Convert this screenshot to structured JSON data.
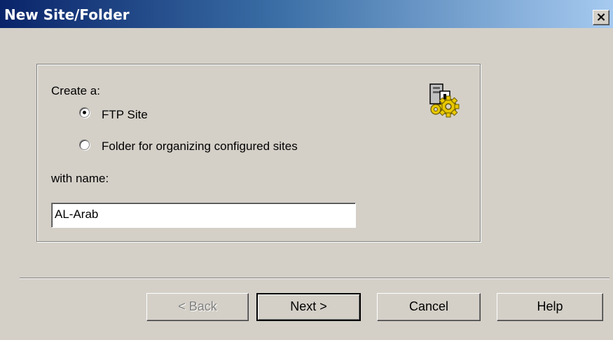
{
  "window": {
    "title": "New Site/Folder",
    "close_glyph": "×"
  },
  "form": {
    "create_label": "Create a:",
    "options": [
      {
        "label": "FTP Site",
        "checked": true
      },
      {
        "label": "Folder for organizing configured sites",
        "checked": false
      }
    ],
    "name_label": "with name:",
    "name_value": "AL-Arab",
    "icon": "ftp-site-gear-icon"
  },
  "buttons": {
    "back": "< Back",
    "next": "Next >",
    "cancel": "Cancel",
    "help": "Help"
  },
  "colors": {
    "title_start": "#0a246a",
    "title_end": "#a6caf0",
    "face": "#d4d0c8"
  }
}
